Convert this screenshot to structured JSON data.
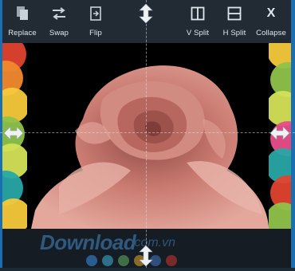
{
  "toolbar": {
    "replace_label": "Replace",
    "swap_label": "Swap",
    "flip_label": "Flip",
    "vsplit_label": "V Split",
    "hsplit_label": "H Split",
    "collapse_label": "Collapse",
    "collapse_glyph": "X"
  },
  "watermark": {
    "brand": "Download",
    "domain": ".com.vn"
  },
  "colors": {
    "accent": "#1a6fb3",
    "toolbar_bg": "#222b33",
    "rose": "#c97a70",
    "pattern": [
      "#e0432f",
      "#f08a2e",
      "#f5c93b",
      "#8fc24a",
      "#27a7a5",
      "#d4e157",
      "#e84d8a"
    ]
  },
  "icons": {
    "replace": "copy-pages-icon",
    "swap": "swap-arrows-icon",
    "flip": "flip-icon",
    "vsplit": "vertical-split-icon",
    "hsplit": "horizontal-split-icon",
    "collapse": "collapse-x-icon"
  }
}
